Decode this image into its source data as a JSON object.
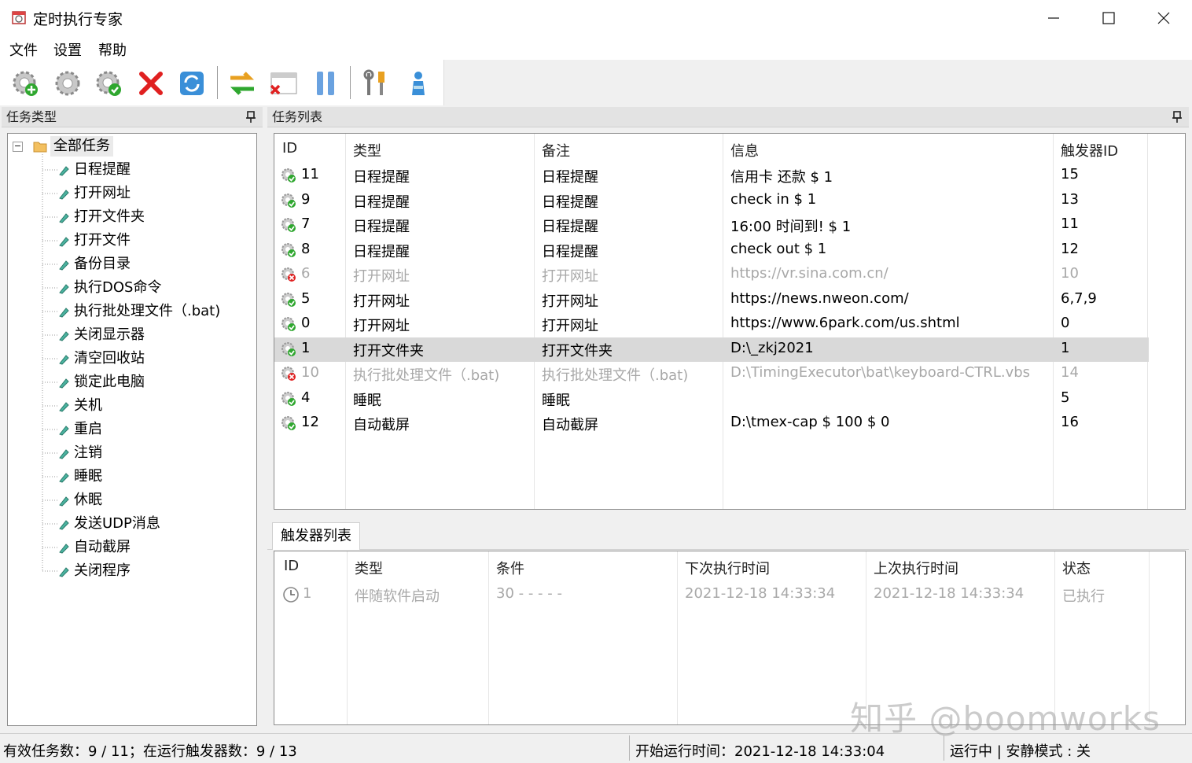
{
  "window": {
    "title": "定时执行专家"
  },
  "menu": [
    "文件",
    "设置",
    "帮助"
  ],
  "toolbar": {
    "buttons": [
      {
        "icon": "add-task-gear-icon"
      },
      {
        "icon": "settings-gear-icon"
      },
      {
        "icon": "enable-gear-icon"
      },
      {
        "icon": "delete-x-icon"
      },
      {
        "icon": "refresh-icon"
      },
      {
        "icon": "swap-arrows-icon"
      },
      {
        "icon": "close-window-icon"
      },
      {
        "icon": "pause-icon"
      },
      {
        "icon": "tools-icon"
      },
      {
        "icon": "user-icon"
      }
    ]
  },
  "left_panel": {
    "title": "任务类型",
    "root": "全部任务",
    "items": [
      "日程提醒",
      "打开网址",
      "打开文件夹",
      "打开文件",
      "备份目录",
      "执行DOS命令",
      "执行批处理文件（.bat)",
      "关闭显示器",
      "清空回收站",
      "锁定此电脑",
      "关机",
      "重启",
      "注销",
      "睡眠",
      "休眠",
      "发送UDP消息",
      "自动截屏",
      "关闭程序"
    ]
  },
  "task_panel": {
    "title": "任务列表",
    "columns": [
      "ID",
      "类型",
      "备注",
      "信息",
      "触发器ID"
    ],
    "rows": [
      {
        "id": "11",
        "type": "日程提醒",
        "note": "日程提醒",
        "info": "信用卡 还款 $ 1",
        "trigger": "15",
        "status": "ok"
      },
      {
        "id": "9",
        "type": "日程提醒",
        "note": "日程提醒",
        "info": "check in $ 1",
        "trigger": "13",
        "status": "ok"
      },
      {
        "id": "7",
        "type": "日程提醒",
        "note": "日程提醒",
        "info": "16:00 时间到!  $ 1",
        "trigger": "11",
        "status": "ok"
      },
      {
        "id": "8",
        "type": "日程提醒",
        "note": "日程提醒",
        "info": "check out $ 1",
        "trigger": "12",
        "status": "ok"
      },
      {
        "id": "6",
        "type": "打开网址",
        "note": "打开网址",
        "info": "https://vr.sina.com.cn/",
        "trigger": "10",
        "status": "disabled"
      },
      {
        "id": "5",
        "type": "打开网址",
        "note": "打开网址",
        "info": "https://news.nweon.com/",
        "trigger": "6,7,9",
        "status": "ok"
      },
      {
        "id": "0",
        "type": "打开网址",
        "note": "打开网址",
        "info": "https://www.6park.com/us.shtml",
        "trigger": "0",
        "status": "ok"
      },
      {
        "id": "1",
        "type": "打开文件夹",
        "note": "打开文件夹",
        "info": "D:\\_zkj2021",
        "trigger": "1",
        "status": "ok",
        "selected": true
      },
      {
        "id": "10",
        "type": "执行批处理文件（.bat)",
        "note": "执行批处理文件（.bat)",
        "info": "D:\\TimingExecutor\\bat\\keyboard-CTRL.vbs",
        "trigger": "14",
        "status": "disabled"
      },
      {
        "id": "4",
        "type": "睡眠",
        "note": "睡眠",
        "info": "",
        "trigger": "5",
        "status": "ok"
      },
      {
        "id": "12",
        "type": "自动截屏",
        "note": "自动截屏",
        "info": "D:\\tmex-cap $ 100 $ 0",
        "trigger": "16",
        "status": "ok"
      }
    ]
  },
  "trigger_panel": {
    "tab": "触发器列表",
    "columns": [
      "ID",
      "类型",
      "条件",
      "下次执行时间",
      "上次执行时间",
      "状态"
    ],
    "rows": [
      {
        "id": "1",
        "type": "伴随软件启动",
        "cond": "30 - - - - -",
        "next": "2021-12-18 14:33:34",
        "last": "2021-12-18 14:33:34",
        "state": "已执行"
      }
    ]
  },
  "status": {
    "left": "有效任务数：9 / 11；在运行触发器数：9 / 13",
    "middle": "开始运行时间：2021-12-18 14:33:04",
    "right": "运行中 | 安静模式 : 关"
  },
  "watermark": "知乎 @boomworks",
  "colors": {
    "selected_row": "#d9d9d9",
    "dim_text": "#a8a8a8",
    "delete_red": "#e02020",
    "ok_green": "#2fa72f"
  }
}
